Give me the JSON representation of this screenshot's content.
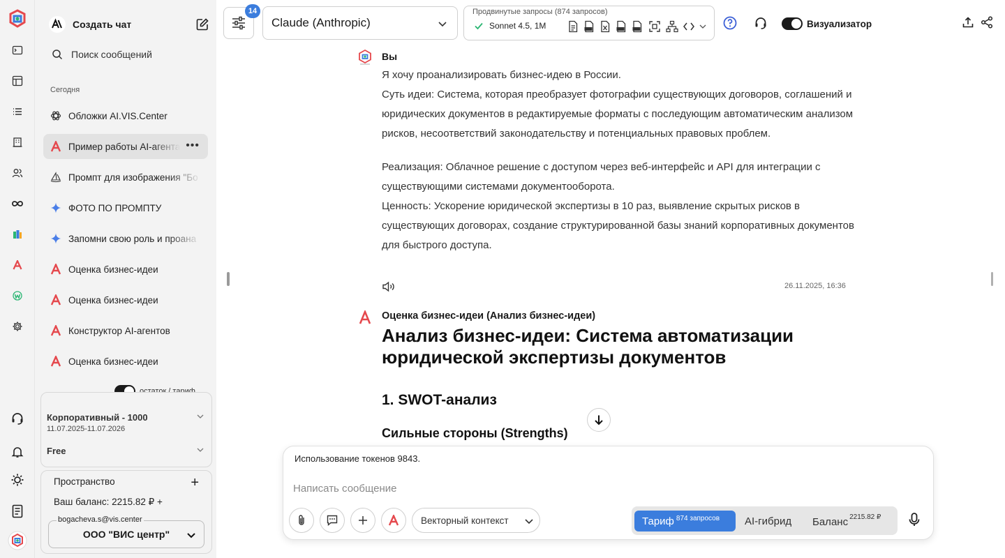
{
  "sidebar": {
    "new_chat": "Создать чат",
    "search": "Поиск сообщений",
    "section_today": "Сегодня",
    "chats": [
      {
        "title": "Обложки AI.VIS.Center",
        "icon": "openai-icon",
        "active": false
      },
      {
        "title": "Пример работы AI-агента",
        "icon": "agent-a-icon",
        "active": true
      },
      {
        "title": "Промпт для изображения \"Бо",
        "icon": "midjourney-icon",
        "active": false
      },
      {
        "title": "ФОТО ПО ПРОМПТУ",
        "icon": "gemini-sparkle-icon",
        "active": false
      },
      {
        "title": "Запомни свою роль и проана",
        "icon": "gemini-sparkle-icon",
        "active": false
      },
      {
        "title": "Оценка бизнес-идеи",
        "icon": "agent-a-icon",
        "active": false
      },
      {
        "title": "Оценка бизнес-идеи",
        "icon": "agent-a-icon",
        "active": false
      },
      {
        "title": "Конструктор AI-агентов",
        "icon": "agent-a-icon",
        "active": false
      },
      {
        "title": "Оценка бизнес-идеи",
        "icon": "agent-a-icon",
        "active": false
      }
    ],
    "remain_toggle_label": "остаток / тариф",
    "plan": {
      "name": "Корпоративный - 1000",
      "dates": "11.07.2025-11.07.2026",
      "tier": "Free"
    },
    "space": {
      "title": "Пространство",
      "add": "+",
      "balance": "Ваш баланс: 2215.82 ₽ +",
      "email": "bogacheva.s@vis.center",
      "org": "ООО \"ВИС центр\""
    }
  },
  "topbar": {
    "filter_badge": "14",
    "model": "Claude (Anthropic)",
    "advanced_caption": "Продвинутые запросы (874 запросов)",
    "advanced_selected": "Sonnet 4.5, 1M",
    "visualizer_label": "Визуализатор"
  },
  "conversation": {
    "user_name": "Вы",
    "user_paragraphs": [
      "Я хочу проанализировать бизнес-идею в России.",
      "Суть идеи: Система, которая преобразует фотографии существующих договоров, соглашений и юридических документов в редактируемые форматы с последующим автоматическим анализом рисков, несоответствий законодательству и потенциальных правовых проблем.",
      "Реализация: Облачное решение с доступом через веб-интерфейс и API для интеграции с существующими системами документооборота.",
      "Ценность: Ускорение юридической экспертизы в 10 раз, выявление скрытых рисков в существующих договорах, создание структурированной базы знаний корпоративных документов для быстрого доступа."
    ],
    "timestamp": "26.11.2025, 16:36",
    "bot_name": "Оценка бизнес-идеи (Анализ бизнес-идеи)",
    "h1": "Анализ бизнес-идеи: Система автоматизации юридической экспертизы документов",
    "h2": "1. SWOT-анализ",
    "h3": "Сильные стороны (Strengths)"
  },
  "composer": {
    "usage": "Использование токенов 9843.",
    "placeholder": "Написать сообщение",
    "vector_context": "Векторный контекст",
    "seg_tariff": "Тариф",
    "seg_tariff_sup": "874 запросов",
    "seg_hybrid": "AI-гибрид",
    "seg_balance": "Баланс",
    "seg_balance_sup": "2215.82 ₽"
  },
  "colors": {
    "accent": "#3b7ddd",
    "agent_red": "#e5484d",
    "sidebar_bg": "#f3f3f3"
  }
}
